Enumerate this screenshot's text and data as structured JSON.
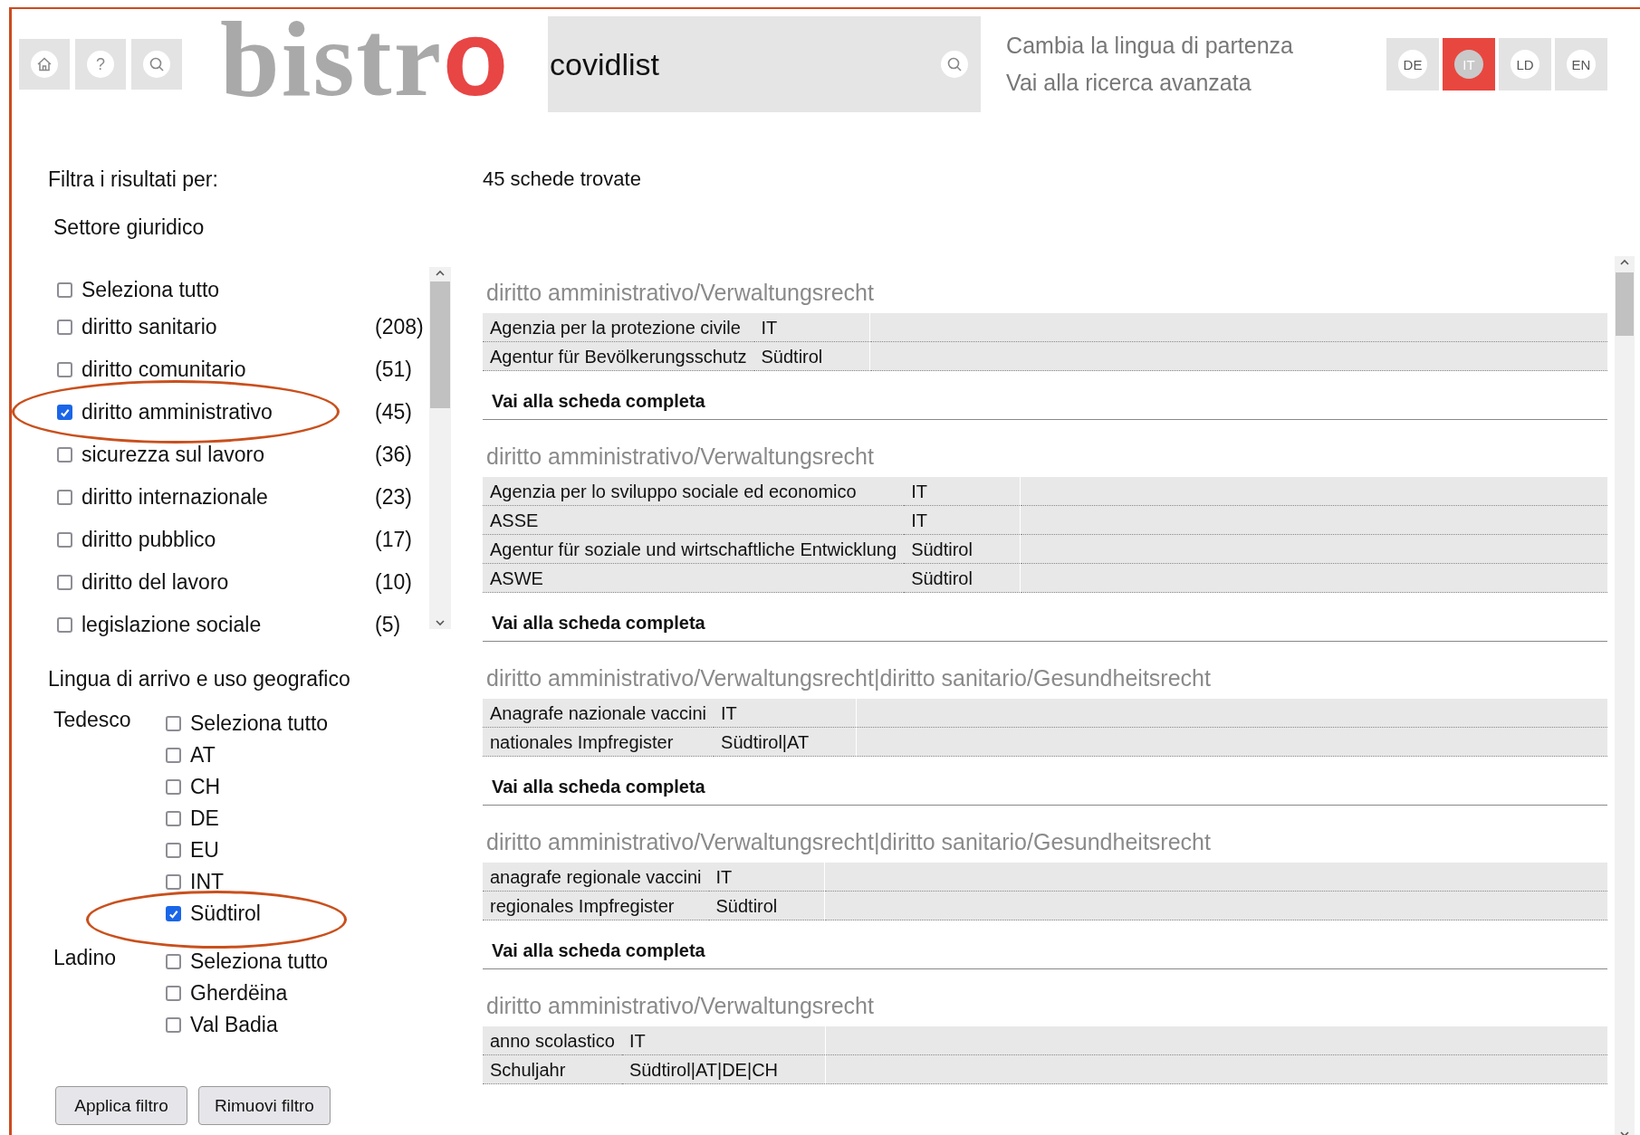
{
  "header": {
    "nav_buttons": [
      {
        "kind": "home"
      },
      {
        "kind": "help",
        "label": "?"
      },
      {
        "kind": "search"
      }
    ],
    "logo": {
      "main": "bistr",
      "accent": "o"
    },
    "search": {
      "value": "covidlist"
    },
    "links": [
      "Cambia la lingua di partenza",
      "Vai alla ricerca avanzata"
    ],
    "languages": [
      {
        "label": "DE",
        "selected": false
      },
      {
        "label": "IT",
        "selected": true
      },
      {
        "label": "LD",
        "selected": false
      },
      {
        "label": "EN",
        "selected": false
      }
    ]
  },
  "filters": {
    "title": "Filtra i risultati per:",
    "sector": {
      "title": "Settore giuridico",
      "items": [
        {
          "label": "Seleziona tutto",
          "checked": false,
          "circled": false
        },
        {
          "label": "diritto sanitario",
          "count": "(208)",
          "checked": false,
          "circled": false
        },
        {
          "label": "diritto comunitario",
          "count": "(51)",
          "checked": false,
          "circled": false
        },
        {
          "label": "diritto amministrativo",
          "count": "(45)",
          "checked": true,
          "circled": true
        },
        {
          "label": "sicurezza sul lavoro",
          "count": "(36)",
          "checked": false,
          "circled": false
        },
        {
          "label": "diritto internazionale",
          "count": "(23)",
          "checked": false,
          "circled": false
        },
        {
          "label": "diritto pubblico",
          "count": "(17)",
          "checked": false,
          "circled": false
        },
        {
          "label": "diritto del lavoro",
          "count": "(10)",
          "checked": false,
          "circled": false
        },
        {
          "label": "legislazione sociale",
          "count": "(5)",
          "checked": false,
          "circled": false
        }
      ]
    },
    "geo": {
      "title": "Lingua di arrivo e uso geografico",
      "groups": [
        {
          "language": "Tedesco",
          "items": [
            {
              "label": "Seleziona tutto",
              "checked": false,
              "circled": false
            },
            {
              "label": "AT",
              "checked": false,
              "circled": false
            },
            {
              "label": "CH",
              "checked": false,
              "circled": false
            },
            {
              "label": "DE",
              "checked": false,
              "circled": false
            },
            {
              "label": "EU",
              "checked": false,
              "circled": false
            },
            {
              "label": "INT",
              "checked": false,
              "circled": false
            },
            {
              "label": "Südtirol",
              "checked": true,
              "circled": true
            }
          ]
        },
        {
          "language": "Ladino",
          "items": [
            {
              "label": "Seleziona tutto",
              "checked": false,
              "circled": false
            },
            {
              "label": "Gherdëina",
              "checked": false,
              "circled": false
            },
            {
              "label": "Val Badia",
              "checked": false,
              "circled": false
            }
          ]
        }
      ]
    },
    "buttons": [
      "Applica filtro",
      "Rimuovi filtro"
    ]
  },
  "results": {
    "count": "45 schede trovate",
    "entries": [
      {
        "domain": "diritto amministrativo/Verwaltungsrecht",
        "rows": [
          [
            "Agenzia per la protezione civile",
            "IT"
          ],
          [
            "Agentur für Bevölkerungsschutz",
            "Südtirol"
          ]
        ],
        "link": "Vai alla scheda completa"
      },
      {
        "domain": "diritto amministrativo/Verwaltungsrecht",
        "rows": [
          [
            "Agenzia per lo sviluppo sociale ed economico",
            "IT"
          ],
          [
            "ASSE",
            "IT"
          ],
          [
            "Agentur für soziale und wirtschaftliche Entwicklung",
            "Südtirol"
          ],
          [
            "ASWE",
            "Südtirol"
          ]
        ],
        "link": "Vai alla scheda completa"
      },
      {
        "domain": "diritto amministrativo/Verwaltungsrecht|diritto sanitario/Gesundheitsrecht",
        "rows": [
          [
            "Anagrafe nazionale vaccini",
            "IT"
          ],
          [
            "nationales Impfregister",
            "Südtirol|AT"
          ]
        ],
        "link": "Vai alla scheda completa"
      },
      {
        "domain": "diritto amministrativo/Verwaltungsrecht|diritto sanitario/Gesundheitsrecht",
        "rows": [
          [
            "anagrafe regionale vaccini",
            "IT"
          ],
          [
            "regionales Impfregister",
            "Südtirol"
          ]
        ],
        "link": "Vai alla scheda completa"
      },
      {
        "domain": "diritto amministrativo/Verwaltungsrecht",
        "rows": [
          [
            "anno scolastico",
            "IT"
          ],
          [
            "Schuljahr",
            "Südtirol|AT|DE|CH"
          ]
        ]
      }
    ]
  }
}
